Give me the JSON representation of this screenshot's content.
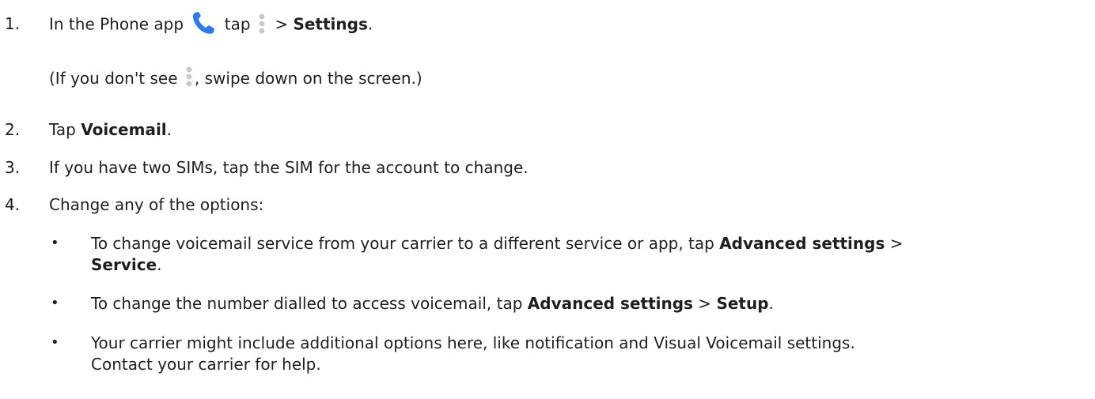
{
  "steps": {
    "s1": {
      "num": "1.",
      "pre": "In the Phone app",
      "mid": "tap",
      "gt": ">",
      "bold": "Settings",
      "end": "."
    },
    "s1_note": {
      "pre": "(If you don't see",
      "post": ", swipe down on the screen.)"
    },
    "s2": {
      "num": "2.",
      "pre": "Tap ",
      "bold": "Voicemail",
      "end": "."
    },
    "s3": {
      "num": "3.",
      "text": "If you have two SIMs, tap the SIM for the account to change."
    },
    "s4": {
      "num": "4.",
      "text": "Change any of the options:"
    }
  },
  "bullets": {
    "b1": {
      "mark": "•",
      "pre": "To change voicemail service from your carrier to a different service or app, tap ",
      "bold1": "Advanced settings",
      "gt": " >",
      "bold2": "Service",
      "end": "."
    },
    "b2": {
      "mark": "•",
      "pre": "To change the number dialled to access voicemail, tap ",
      "bold1": "Advanced settings",
      "gt": " > ",
      "bold2": "Setup",
      "end": "."
    },
    "b3": {
      "mark": "•",
      "line1": "Your carrier might include additional options here, like notification and Visual Voicemail settings.",
      "line2": "Contact your carrier for help."
    }
  },
  "icons": {
    "phone": "phone-icon",
    "more": "more-vert-icon",
    "phone_color": "#2f7be8",
    "more_color": "#c8c8c8"
  }
}
